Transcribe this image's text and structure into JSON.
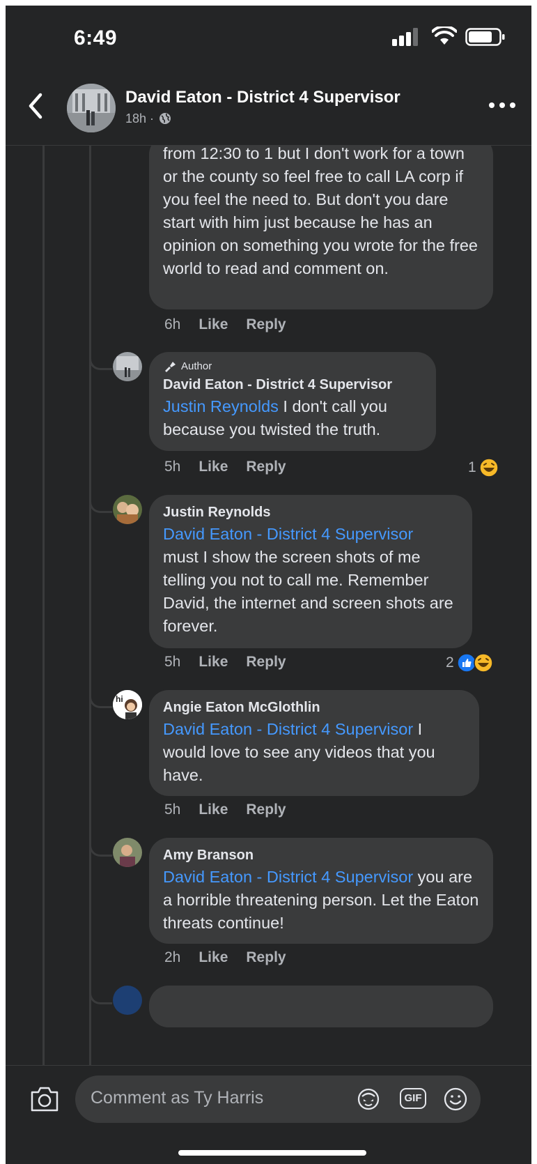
{
  "status_bar": {
    "time": "6:49"
  },
  "header": {
    "title": "David Eaton - District 4 Supervisor",
    "meta": "18h ·"
  },
  "comments": [
    {
      "body": "from 12:30 to 1 but I don't work for a town or the county so feel free to call LA corp if you feel the need to. But don't you dare start with him just because he has an opinion on something you wrote for the free world to read and comment on.",
      "time": "6h",
      "like": "Like",
      "reply": "Reply"
    },
    {
      "author_tag": "Author",
      "name": "David Eaton - District 4 Supervisor",
      "mention": "Justin Reynolds",
      "body": " I don't call you because you twisted the truth.",
      "time": "5h",
      "like": "Like",
      "reply": "Reply",
      "reaction_count": "1"
    },
    {
      "name": "Justin Reynolds",
      "mention": "David Eaton - District 4 Supervisor",
      "body": "must I show the screen shots of me telling you not to call me. Remember David, the internet and screen shots are forever.",
      "time": "5h",
      "like": "Like",
      "reply": "Reply",
      "reaction_count": "2"
    },
    {
      "name": "Angie Eaton McGlothlin",
      "mention": "David Eaton - District 4 Supervisor",
      "body": " I would love to see any videos that you have.",
      "time": "5h",
      "like": "Like",
      "reply": "Reply"
    },
    {
      "name": "Amy Branson",
      "mention": "David Eaton - District 4 Supervisor",
      "body": " you are a horrible threatening person.  Let the Eaton threats continue!",
      "time": "2h",
      "like": "Like",
      "reply": "Reply"
    }
  ],
  "comment_bar": {
    "placeholder": "Comment as Ty Harris",
    "gif_label": "GIF"
  },
  "colors": {
    "background": "#242526",
    "bubble": "#3a3b3c",
    "mention": "#4599ff",
    "text": "#e4e6eb",
    "secondary": "#b0b3b8"
  },
  "icons": [
    "back-icon",
    "globe-icon",
    "more-icon",
    "camera-icon",
    "avatar-sticker-icon",
    "gif-icon",
    "emoji-icon",
    "haha-reaction-icon",
    "like-reaction-icon",
    "author-icon"
  ]
}
